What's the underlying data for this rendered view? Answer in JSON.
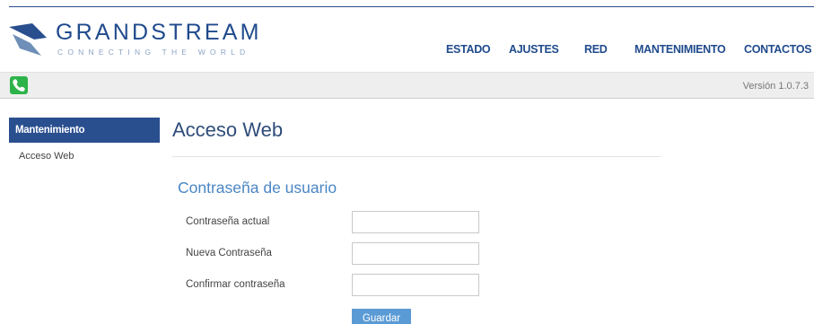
{
  "brand": {
    "name": "GRANDSTREAM",
    "tagline": "CONNECTING THE WORLD"
  },
  "nav": {
    "items": [
      {
        "label": "ESTADO"
      },
      {
        "label": "AJUSTES"
      },
      {
        "label": "RED"
      },
      {
        "label": "MANTENIMIENTO"
      },
      {
        "label": "CONTACTOS"
      }
    ]
  },
  "statusbar": {
    "version": "Versión 1.0.7.3"
  },
  "sidebar": {
    "heading": "Mantenimiento",
    "items": [
      {
        "label": "Acceso Web"
      }
    ]
  },
  "main": {
    "title": "Acceso Web",
    "section_title": "Contraseña de usuario",
    "fields": [
      {
        "label": "Contraseña actual",
        "value": ""
      },
      {
        "label": "Nueva Contraseña",
        "value": ""
      },
      {
        "label": "Confirmar contraseña",
        "value": ""
      }
    ],
    "save_label": "Guardar"
  },
  "colors": {
    "brand_blue": "#2a4f8f",
    "accent_blue": "#4a86c5",
    "button_blue": "#5b9bd5",
    "phone_green": "#2eb34a"
  }
}
